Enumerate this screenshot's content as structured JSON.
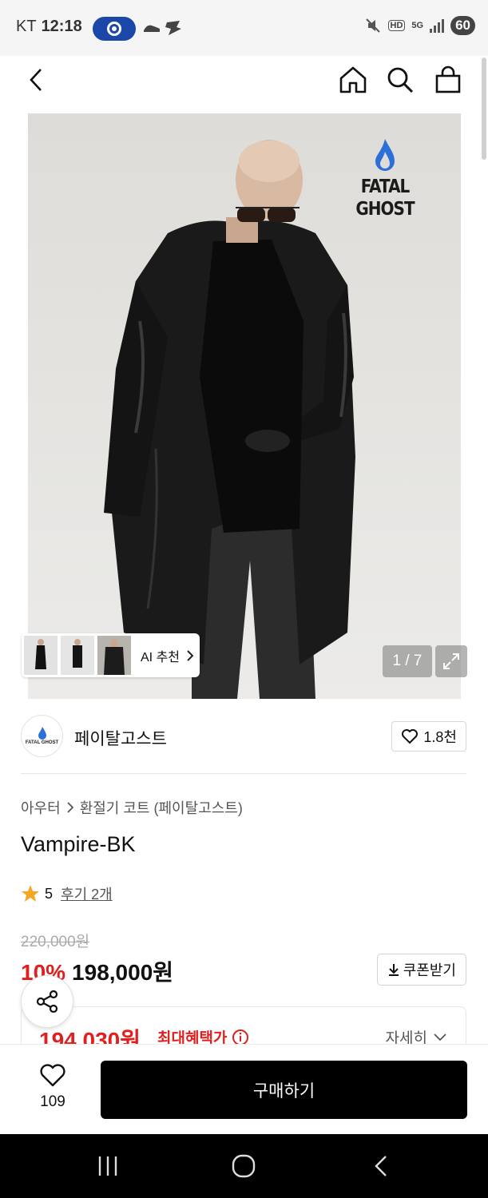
{
  "status_bar": {
    "carrier": "KT",
    "time": "12:18",
    "hd_label": "HD",
    "network_label": "5G",
    "battery": "60"
  },
  "header": {
    "icons": [
      "back-icon",
      "home-icon",
      "search-icon",
      "shopping-bag-icon"
    ]
  },
  "hero": {
    "brand_logo_text": "FATAL GHOST",
    "ai_recommend_label": "AI 추천",
    "image_counter": "1 / 7"
  },
  "brand": {
    "avatar_text": "FATAL GHOST",
    "name": "페이탈고스트",
    "likes": "1.8천"
  },
  "product": {
    "breadcrumb": [
      "아우터",
      "환절기 코트 (페이탈고스트)"
    ],
    "title": "Vampire-BK",
    "rating": "5",
    "review_label": "후기 2개",
    "original_price": "220,000원",
    "discount": "10%",
    "sale_price": "198,000원",
    "coupon_label": "쿠폰받기",
    "max_benefit_price": "194,030원",
    "max_benefit_label": "최대혜택가",
    "detail_label": "자세히"
  },
  "buy_bar": {
    "wish_count": "109",
    "buy_label": "구매하기"
  },
  "colors": {
    "accent_red": "#e0201f",
    "status_pill": "#1a47a8",
    "star": "#f5a623",
    "buy_button": "#000000"
  }
}
